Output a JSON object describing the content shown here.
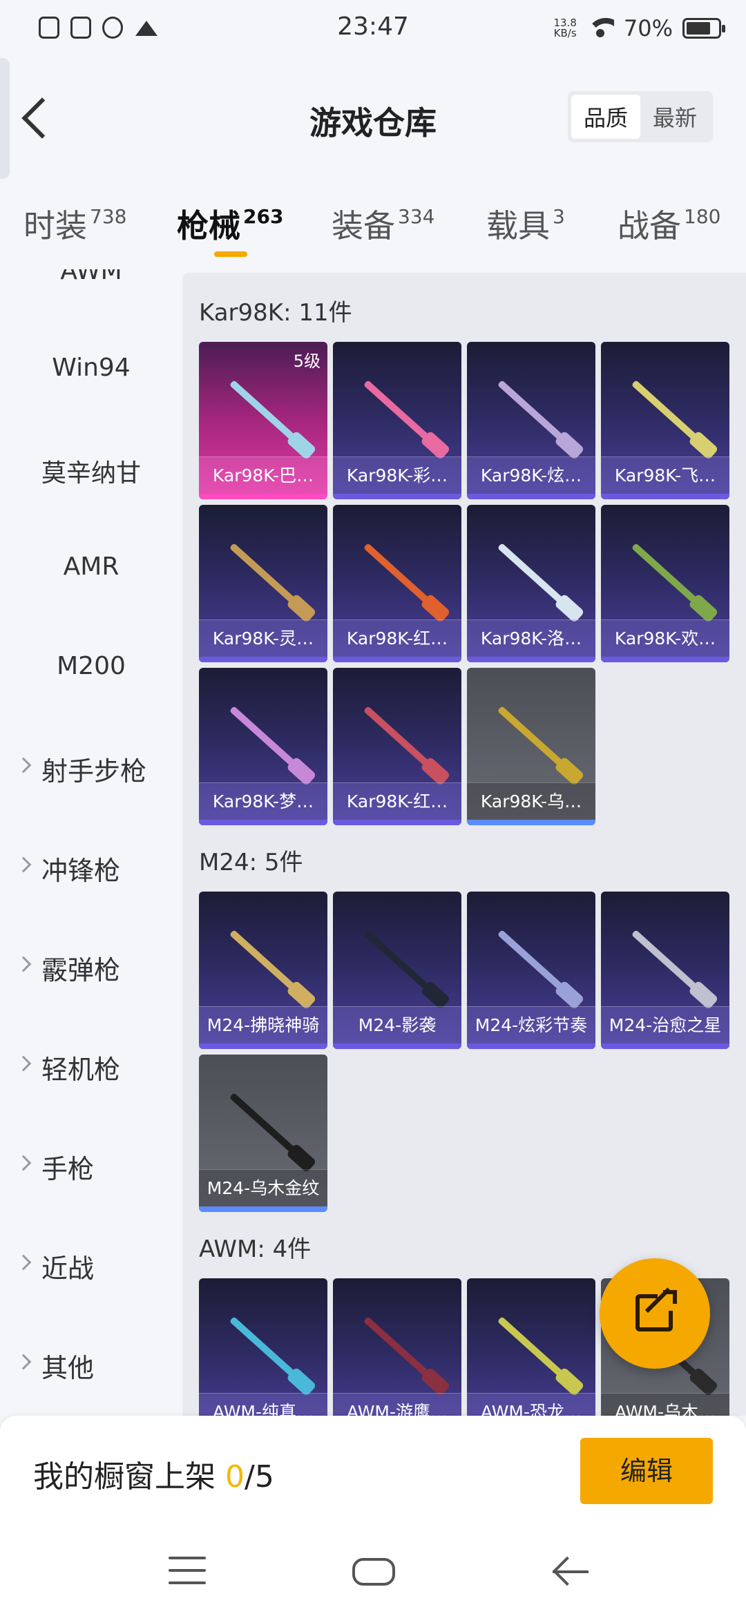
{
  "status_bar": {
    "time": "23:47",
    "net_speed_value": "13.8",
    "net_speed_unit": "KB/s",
    "battery": "70%",
    "icons": [
      "sim-icon",
      "message-icon",
      "q-icon",
      "crown-icon",
      "wifi-icon",
      "battery-icon"
    ]
  },
  "header": {
    "title": "游戏仓库",
    "sort_options": [
      "品质",
      "最新"
    ],
    "active_sort": "品质"
  },
  "category_tabs": [
    {
      "label": "时装",
      "count": "738"
    },
    {
      "label": "枪械",
      "count": "263",
      "active": true
    },
    {
      "label": "装备",
      "count": "334"
    },
    {
      "label": "载具",
      "count": "3"
    },
    {
      "label": "战备",
      "count": "180"
    }
  ],
  "sidebar": {
    "items": [
      {
        "label": "AWM"
      },
      {
        "label": "Win94"
      },
      {
        "label": "莫辛纳甘"
      },
      {
        "label": "AMR"
      },
      {
        "label": "M200"
      },
      {
        "label": "射手步枪"
      },
      {
        "label": "冲锋枪"
      },
      {
        "label": "霰弹枪"
      },
      {
        "label": "轻机枪"
      },
      {
        "label": "手枪"
      },
      {
        "label": "近战"
      },
      {
        "label": "其他"
      }
    ]
  },
  "sections": [
    {
      "title": "Kar98K: 11件",
      "items": [
        {
          "label": "Kar98K-巴…",
          "level": "5级",
          "rarity": "pink"
        },
        {
          "label": "Kar98K-彩…",
          "rarity": "purple"
        },
        {
          "label": "Kar98K-炫…",
          "rarity": "purple"
        },
        {
          "label": "Kar98K-飞…",
          "rarity": "purple"
        },
        {
          "label": "Kar98K-灵…",
          "rarity": "purple"
        },
        {
          "label": "Kar98K-红…",
          "rarity": "purple"
        },
        {
          "label": "Kar98K-洛…",
          "rarity": "purple"
        },
        {
          "label": "Kar98K-欢…",
          "rarity": "purple"
        },
        {
          "label": "Kar98K-梦…",
          "rarity": "purple"
        },
        {
          "label": "Kar98K-红…",
          "rarity": "purple"
        },
        {
          "label": "Kar98K-乌…",
          "rarity": "gray"
        }
      ]
    },
    {
      "title": "M24: 5件",
      "items": [
        {
          "label": "M24-拂晓神骑",
          "rarity": "purple"
        },
        {
          "label": "M24-影袭",
          "rarity": "purple"
        },
        {
          "label": "M24-炫彩节奏",
          "rarity": "purple"
        },
        {
          "label": "M24-治愈之星",
          "rarity": "purple"
        },
        {
          "label": "M24-乌木金纹",
          "rarity": "gray"
        }
      ]
    },
    {
      "title": "AWM: 4件",
      "items": [
        {
          "label": "AWM-纯真…",
          "rarity": "purple"
        },
        {
          "label": "AWM-游鹰…",
          "rarity": "purple"
        },
        {
          "label": "AWM-恐龙…",
          "rarity": "purple"
        },
        {
          "label": "AWM-乌木…",
          "rarity": "gray"
        }
      ]
    }
  ],
  "showcase": {
    "label": "我的橱窗上架",
    "current": "0",
    "separator": "/",
    "max": "5",
    "edit_label": "编辑"
  },
  "colors": {
    "accent": "#f5a800",
    "purple_card": "#4a3f9a",
    "pink_card": "#e33ba8",
    "gray_card": "#5e6069"
  }
}
